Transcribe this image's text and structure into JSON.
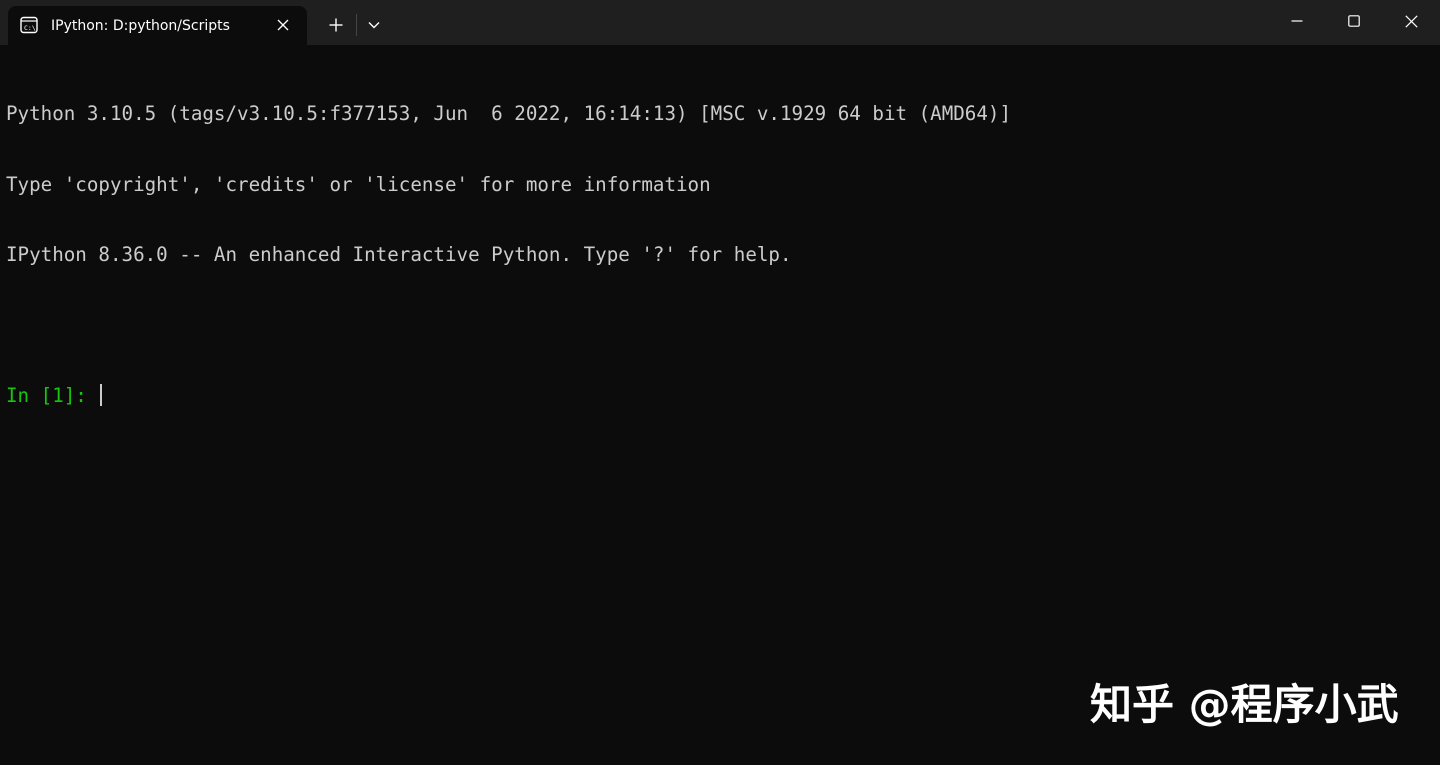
{
  "window": {
    "tab_title": "IPython: D:python/Scripts",
    "tab_icon": "terminal-icon",
    "new_tab_label": "+",
    "controls": {
      "minimize_icon": "minimize-icon",
      "maximize_icon": "maximize-icon",
      "close_icon": "close-icon"
    }
  },
  "terminal": {
    "lines": [
      "Python 3.10.5 (tags/v3.10.5:f377153, Jun  6 2022, 16:14:13) [MSC v.1929 64 bit (AMD64)]",
      "Type 'copyright', 'credits' or 'license' for more information",
      "IPython 8.36.0 -- An enhanced Interactive Python. Type '?' for help."
    ],
    "prompt": "In [1]: ",
    "input": "",
    "colors": {
      "background": "#0c0c0c",
      "foreground": "#cccccc",
      "prompt": "#16c60c",
      "titlebar": "#1f1f1f"
    }
  },
  "watermark": {
    "text": "知乎 @程序小武"
  }
}
